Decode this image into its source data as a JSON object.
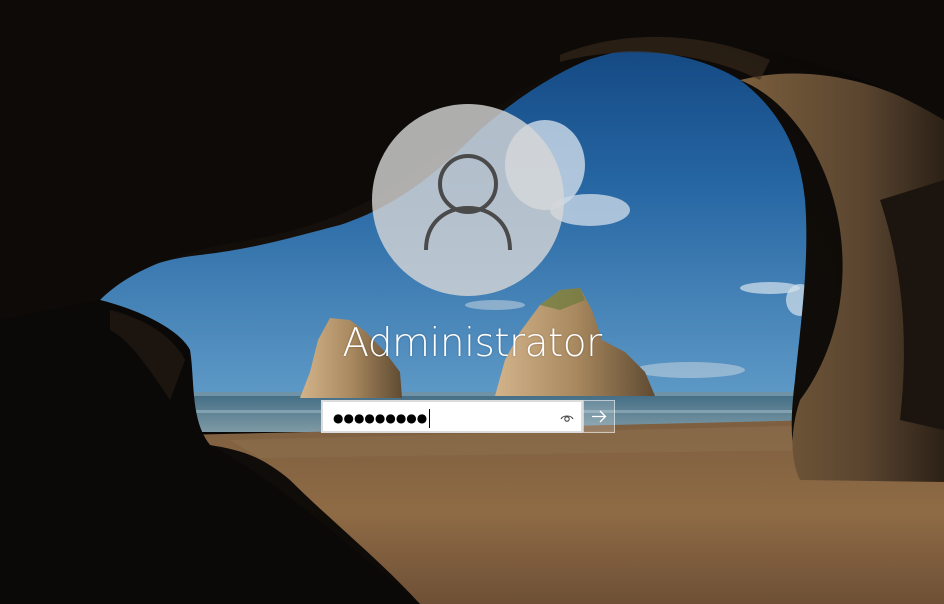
{
  "lock_screen": {
    "username": "Administrator",
    "avatar_icon": "user-silhouette-icon"
  },
  "password_field": {
    "masked_value": "●●●●●●●●●",
    "reveal_icon": "eye-icon"
  },
  "submit": {
    "icon": "arrow-right-icon"
  },
  "colors": {
    "field_border": "#dcdcdc",
    "text": "#ffffff",
    "avatar_bg": "#d7d7d7",
    "glyph": "#4a4a4a"
  }
}
